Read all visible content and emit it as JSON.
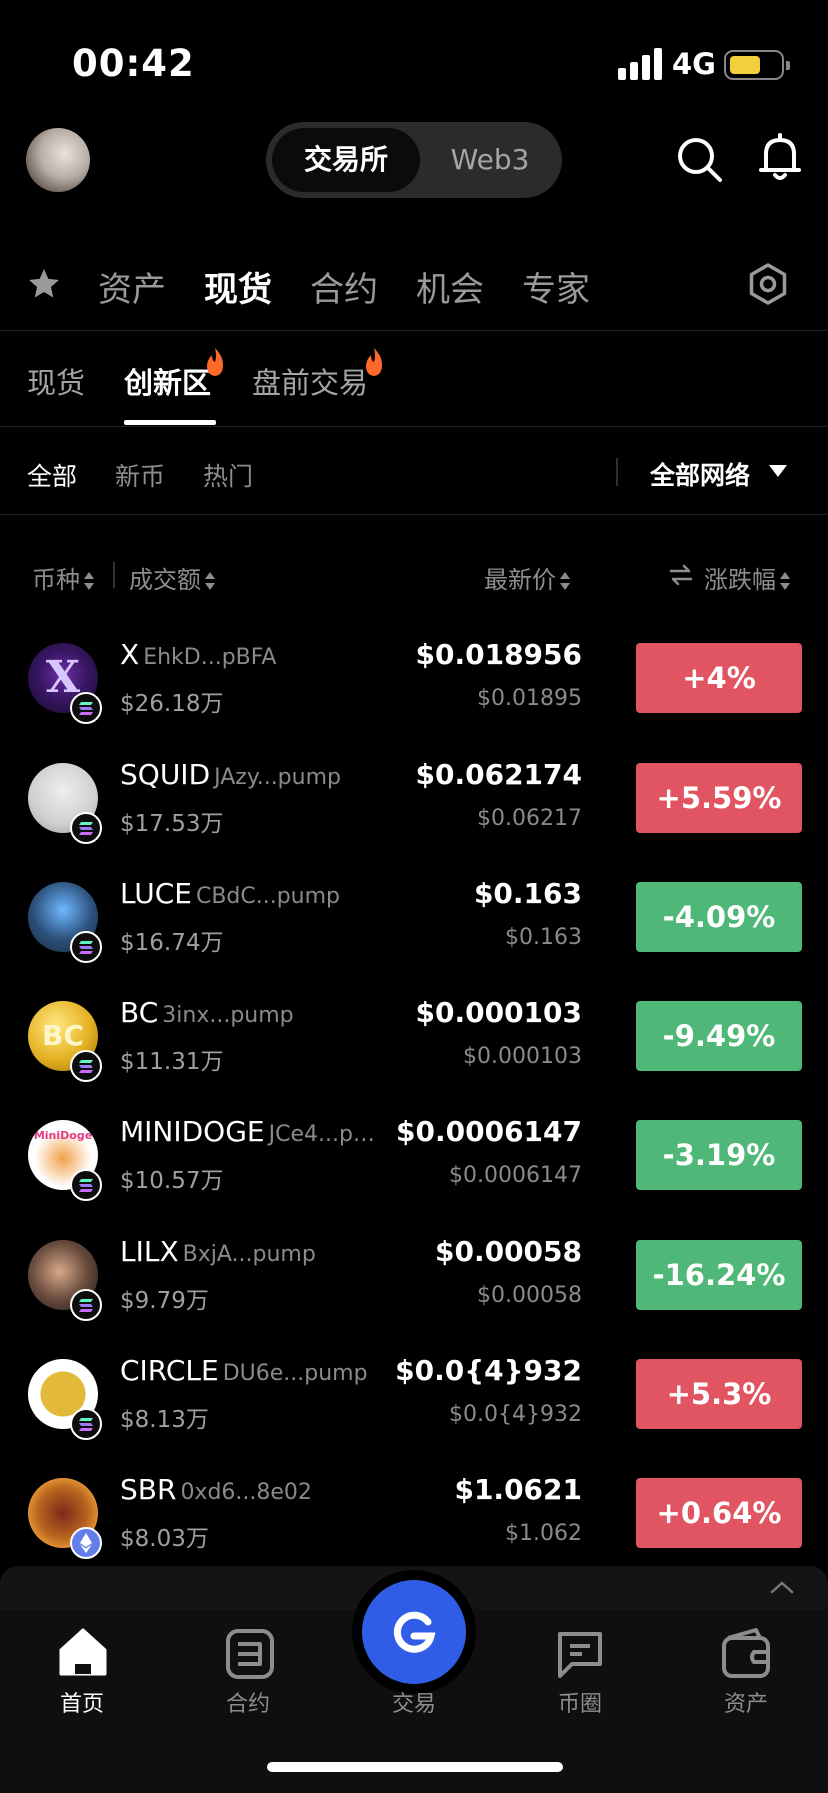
{
  "status": {
    "time": "00:42",
    "network": "4G"
  },
  "header": {
    "segment_active": "交易所",
    "segment_inactive": "Web3"
  },
  "main_tabs": [
    "资产",
    "现货",
    "合约",
    "机会",
    "专家"
  ],
  "sub_tabs": [
    "现货",
    "创新区",
    "盘前交易"
  ],
  "filters": {
    "items": [
      "全部",
      "新币",
      "热门"
    ],
    "network": "全部网络"
  },
  "columns": {
    "coin": "币种",
    "volume": "成交额",
    "price": "最新价",
    "change": "涨跌幅"
  },
  "rows": [
    {
      "symbol": "X",
      "addr": "EhkD...pBFA",
      "volume": "$26.18万",
      "price": "$0.018956",
      "sub": "$0.01895",
      "change": "+4%",
      "dir": "up",
      "chain": "sol"
    },
    {
      "symbol": "SQUID",
      "addr": "JAzy...pump",
      "volume": "$17.53万",
      "price": "$0.062174",
      "sub": "$0.06217",
      "change": "+5.59%",
      "dir": "up",
      "chain": "sol"
    },
    {
      "symbol": "LUCE",
      "addr": "CBdC...pump",
      "volume": "$16.74万",
      "price": "$0.163",
      "sub": "$0.163",
      "change": "-4.09%",
      "dir": "down",
      "chain": "sol"
    },
    {
      "symbol": "BC",
      "addr": "3inx...pump",
      "volume": "$11.31万",
      "price": "$0.000103",
      "sub": "$0.000103",
      "change": "-9.49%",
      "dir": "down",
      "chain": "sol"
    },
    {
      "symbol": "MINIDOGE",
      "addr": "JCe4...p…",
      "volume": "$10.57万",
      "price": "$0.0006147",
      "sub": "$0.0006147",
      "change": "-3.19%",
      "dir": "down",
      "chain": "sol"
    },
    {
      "symbol": "LILX",
      "addr": "BxjA...pump",
      "volume": "$9.79万",
      "price": "$0.00058",
      "sub": "$0.00058",
      "change": "-16.24%",
      "dir": "down",
      "chain": "sol"
    },
    {
      "symbol": "CIRCLE",
      "addr": "DU6e...pump",
      "volume": "$8.13万",
      "price": "$0.0{4}932",
      "sub": "$0.0{4}932",
      "change": "+5.3%",
      "dir": "up",
      "chain": "sol"
    },
    {
      "symbol": "SBR",
      "addr": "0xd6...8e02",
      "volume": "$8.03万",
      "price": "$1.0621",
      "sub": "$1.062",
      "change": "+0.64%",
      "dir": "up",
      "chain": "eth"
    }
  ],
  "coin_logos": {
    "BC": "BC",
    "MINIDOGE": "MiniDoge"
  },
  "bottom_nav": [
    "首页",
    "合约",
    "交易",
    "币圈",
    "资产"
  ],
  "colors": {
    "up": "#e05561",
    "down": "#4fb878",
    "accent": "#2f5de8",
    "flame": "#ff6a2b"
  },
  "icons": [
    "star-icon",
    "search-icon",
    "bell-icon",
    "settings-icon",
    "flame-icon",
    "caret-down-icon",
    "swap-icon",
    "solana-chain-icon",
    "ethereum-chain-icon",
    "home-icon",
    "contract-icon",
    "trade-icon",
    "chat-icon",
    "wallet-icon",
    "chevron-up-icon"
  ]
}
